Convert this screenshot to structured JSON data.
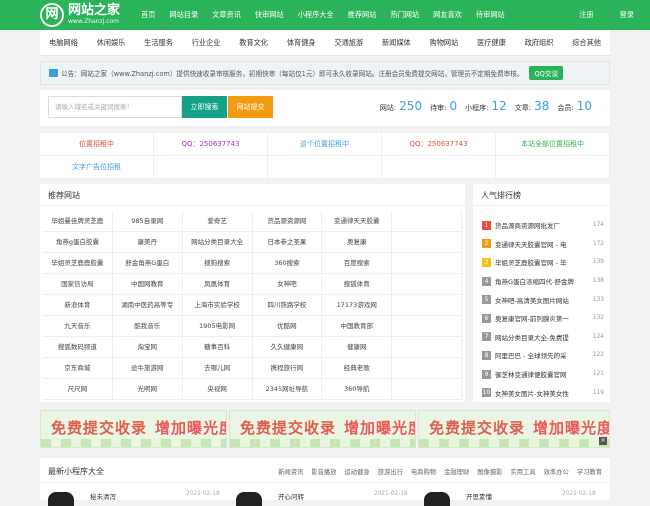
{
  "header": {
    "logo_text": "网站之家",
    "logo_sub": "www.Zhanzj.com",
    "logo_mark": "网",
    "nav": [
      "首页",
      "网站目录",
      "文章资讯",
      "快审网站",
      "小程序大全",
      "推荐网站",
      "热门网站",
      "网友喜欢",
      "待审网站"
    ],
    "login": "注册",
    "register": "登录"
  },
  "categories": [
    "电脑网络",
    "休闲娱乐",
    "生活服务",
    "行业企业",
    "教育文化",
    "体育健身",
    "交通旅游",
    "新闻媒体",
    "购物网站",
    "医疗健康",
    "政府组织",
    "综合其他"
  ],
  "notice": {
    "text": "公告：网站之家（www.Zhanzj.com）提供快速收录审核服务，初期快审（每站仅1元）即可永久收录网站。注册会员免费提交网站，管理员不定期免费审核。",
    "qq_label": "QQ交谈"
  },
  "search": {
    "placeholder": "请输入域名或关键词搜索！",
    "search_label": "立即搜索",
    "submit_label": "网站提交",
    "stats": [
      {
        "label": "网站:",
        "value": "250"
      },
      {
        "label": "待审:",
        "value": "0"
      },
      {
        "label": "小程序:",
        "value": "12"
      },
      {
        "label": "文章:",
        "value": "38"
      },
      {
        "label": "会员:",
        "value": "10"
      }
    ]
  },
  "ads": [
    {
      "text": "位置招租中",
      "color": "#e74c3c"
    },
    {
      "text": "QQ：250637743",
      "color": "#b02cd9"
    },
    {
      "text": "这个位置招租中",
      "color": "#3ba0d9"
    },
    {
      "text": "QQ：250637743",
      "color": "#e74c3c"
    },
    {
      "text": "本站全部位置招租中",
      "color": "#2bb35a"
    },
    {
      "text": "文字广告位招租",
      "color": "#3ba0d9"
    },
    {
      "text": "",
      "color": "#333"
    },
    {
      "text": "",
      "color": "#333"
    },
    {
      "text": "",
      "color": "#333"
    },
    {
      "text": "",
      "color": "#333"
    }
  ],
  "recommend": {
    "title": "推荐网站",
    "sites": [
      "毕姐曼佳牌灵芝鹿",
      "985自录网",
      "爱奇艺",
      "货品源资源网",
      "变通律天天胶囊",
      "",
      "角燕g蛋白胶囊",
      "康美丹",
      "网站分类目录大全",
      "日本参之圣果",
      "奥复康",
      "",
      "毕姐灵芝鹿鹿胶囊",
      "舒金角燕G蛋白",
      "搜狗搜索",
      "360搜索",
      "百度搜索",
      "",
      "国家信访局",
      "中国网教育",
      "凤凰体育",
      "女神吧",
      "搜狐体育",
      "",
      "新浪体育",
      "湖南中医药高等专",
      "上海市实验学校",
      "四川铁路学校",
      "17173游戏网",
      "",
      "九天音乐",
      "酷我音乐",
      "1905电影网",
      "优酷网",
      "中国教育部",
      "",
      "搜狐数码频道",
      "淘宝网",
      "糖事百科",
      "久久健康网",
      "健康网",
      "",
      "京东商城",
      "途牛旅游网",
      "去哪儿网",
      "携程旅行网",
      "经典老歌",
      "",
      "尺尺网",
      "光明网",
      "央视网",
      "2345网址导航",
      "360导航",
      ""
    ]
  },
  "hot": {
    "title": "人气排行榜",
    "items": [
      {
        "rank": "1",
        "text": "货品源商资源网批发厂",
        "count": "174",
        "color": "#e74c3c"
      },
      {
        "rank": "2",
        "text": "变通律天天胶囊官网 - 电",
        "count": "172",
        "color": "#f39c12"
      },
      {
        "rank": "3",
        "text": "毕姐灵芝鹿胶囊官网 - 毕",
        "count": "139",
        "color": "#f1c40f"
      },
      {
        "rank": "4",
        "text": "角燕G蛋白浓缩四代-舒金牌",
        "count": "138",
        "color": "#999999"
      },
      {
        "rank": "5",
        "text": "女神吧-高清美女图片网站",
        "count": "133",
        "color": "#999999"
      },
      {
        "rank": "6",
        "text": "奥复康官网-前列腺炎第一",
        "count": "132",
        "color": "#999999"
      },
      {
        "rank": "7",
        "text": "网站分类目录大全-免费提",
        "count": "124",
        "color": "#999999"
      },
      {
        "rank": "8",
        "text": "阿里巴巴 - 全球领先的采",
        "count": "122",
        "color": "#999999"
      },
      {
        "rank": "9",
        "text": "御芝林变通律便胶囊官网",
        "count": "121",
        "color": "#999999"
      },
      {
        "rank": "10",
        "text": "女神美女图片-女神美女性",
        "count": "119",
        "color": "#999999"
      }
    ]
  },
  "banner": {
    "text1": "免费提交收录",
    "text2": "增加曝光度!",
    "close": "×"
  },
  "mini": {
    "title": "最新小程序大全",
    "tabs": [
      "新闻资讯",
      "影音播放",
      "运动健身",
      "旅游出行",
      "电商购物",
      "金融理财",
      "图像摄影",
      "实用工具",
      "效率办公",
      "学习教育"
    ],
    "rows": [
      {
        "name": "秘未清泻",
        "date": "2021-02-18"
      },
      {
        "name": "开心问转",
        "date": "2021-02-18"
      },
      {
        "name": "开思素懂",
        "date": "2021-02-18"
      }
    ]
  }
}
